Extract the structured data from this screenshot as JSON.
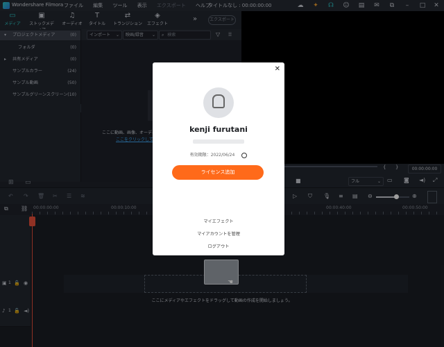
{
  "app": {
    "title": "Wondershare Filmora",
    "project": "タイトルなし : 00:00:00:00"
  },
  "menu": [
    "ファイル",
    "編集",
    "ツール",
    "表示",
    "エクスポート",
    "ヘルプ"
  ],
  "tabs": [
    "メディア",
    "ストックメディア",
    "オーディオ",
    "タイトル",
    "トランジション",
    "エフェクト"
  ],
  "export_button": "エクスポート",
  "library": [
    {
      "label": "プロジェクトメディア",
      "count": "(0)"
    },
    {
      "label": "フォルダ",
      "count": "(0)"
    },
    {
      "label": "共有メディア",
      "count": "(0)"
    },
    {
      "label": "サンプルカラー",
      "count": "(24)"
    },
    {
      "label": "サンプル動画",
      "count": "(50)"
    },
    {
      "label": "サンプルグリーンスクリーン",
      "count": "(10)"
    }
  ],
  "media": {
    "import_label": "インポート",
    "filter_label": "映画/録音",
    "search_placeholder": "検索",
    "hint_line1": "ここに動画、画像、オーディオ",
    "hint_line2": "ここをクリックして、メ"
  },
  "preview": {
    "timecode": "00:00:00:00",
    "quality": "フル"
  },
  "timeline": {
    "ticks": [
      "00:00:00:00",
      "00:00:10:00",
      "00:00:40:00",
      "00:00:50:00"
    ],
    "drop_hint": "ここにメディアやエフェクトをドラッグして動画の作成を開始しましょう。",
    "video_track": "1",
    "audio_track": "1"
  },
  "modal": {
    "username": "kenji furutani",
    "expiry": "有効期限：2022/06/24",
    "license_button": "ライセンス追加",
    "links": [
      "マイエフェクト",
      "マイアカウントを管理",
      "ログアウト"
    ]
  },
  "colors": {
    "accent": "#2ec8c8",
    "orange": "#ff6a1a",
    "playhead": "#e8503a"
  }
}
